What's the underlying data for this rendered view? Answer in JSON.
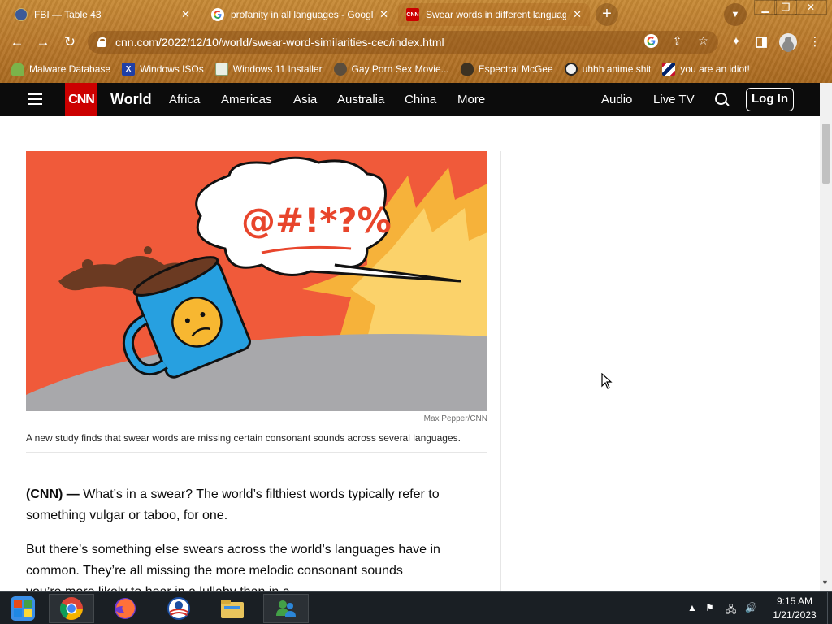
{
  "tabs": [
    {
      "title": "FBI — Table 43",
      "icon": "fbi-seal-icon"
    },
    {
      "title": "profanity in all languages - Google",
      "icon": "google-g-icon"
    },
    {
      "title": "Swear words in different languag",
      "icon": "cnn-icon",
      "favicon_text": "CNN"
    }
  ],
  "address_bar": {
    "url": "cnn.com/2022/12/10/world/swear-word-similarities-cec/index.html"
  },
  "bookmarks": [
    {
      "label": "Malware Database"
    },
    {
      "label": "Windows ISOs"
    },
    {
      "label": "Windows 11 Installer"
    },
    {
      "label": "Gay Porn Sex Movie..."
    },
    {
      "label": "Espectral McGee"
    },
    {
      "label": "uhhh anime shit"
    },
    {
      "label": "you are an idiot!"
    }
  ],
  "cnn_nav": {
    "logo": "CNN",
    "section": "World",
    "links": [
      "Africa",
      "Americas",
      "Asia",
      "Australia",
      "China",
      "More"
    ],
    "right_links": [
      "Audio",
      "Live TV"
    ],
    "login": "Log In"
  },
  "article": {
    "image_credit": "Max Pepper/CNN",
    "image_speech_text": "@#!*?%",
    "caption": "A new study finds that swear words are missing certain consonant sounds across several languages.",
    "dateline": "(CNN) —",
    "para1": " What’s in a swear? The world’s filthiest words typically refer to something vulgar or taboo, for one.",
    "para2": "But there’s something else swears across the world’s languages have in common. They’re all missing the more melodic consonant sounds you’re more likely to hear in a lullaby than in a"
  },
  "taskbar": {
    "time": "9:15 AM",
    "date": "1/21/2023"
  },
  "colors": {
    "chrome_brown": "#b8772a",
    "cnn_red": "#cc0000",
    "cnn_nav_black": "#0c0c0c",
    "hero_orange": "#f05a3a",
    "taskbar": "#1a1f24"
  }
}
